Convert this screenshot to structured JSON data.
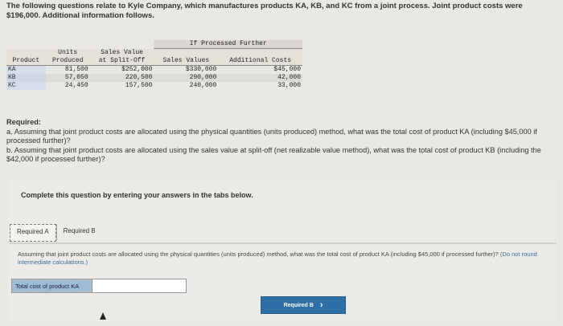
{
  "intro": "The following questions relate to Kyle Company, which manufactures products KA, KB, and KC from a joint process. Joint product costs were $196,000. Additional information follows.",
  "table": {
    "group_header": "If Processed Further",
    "col1a": "",
    "col1b": "Product",
    "col2a": "Units",
    "col2b": "Produced",
    "col3a": "Sales Value",
    "col3b": "at Split-Off",
    "col4a": "",
    "col4b": "Sales Values",
    "col5a": "",
    "col5b": "Additional Costs",
    "rows": [
      {
        "product": "KA",
        "units": "81,500",
        "split_off": "$252,000",
        "sales_values": "$330,000",
        "additional": "$45,000"
      },
      {
        "product": "KB",
        "units": "57,050",
        "split_off": "220,500",
        "sales_values": "290,000",
        "additional": "42,000"
      },
      {
        "product": "KC",
        "units": "24,450",
        "split_off": "157,500",
        "sales_values": "240,000",
        "additional": "33,000"
      }
    ]
  },
  "required": {
    "title": "Required:",
    "a": "a. Assuming that joint product costs are allocated using the physical quantities (units produced) method, what was the total cost of product KA (including $45,000 if processed further)?",
    "b": "b. Assuming that joint product costs are allocated using the sales value at split-off (net realizable value method), what was the total cost of product KB (including the $42,000 if processed further)?"
  },
  "complete_text": "Complete this question by entering your answers in the tabs below.",
  "tabs": [
    {
      "label": "Required A"
    },
    {
      "label": "Required B"
    }
  ],
  "question": {
    "text": "Assuming that joint product costs are allocated using the physical quantities (units produced) method, what was the total cost of product KA (including $45,000 if processed further)? ",
    "note": "(Do not round intermediate calculations.)"
  },
  "answer": {
    "label": "Total cost of product KA",
    "value": ""
  },
  "next_button": {
    "label": "Required B",
    "icon": "chevron-right-icon"
  },
  "colors": {
    "accent": "#2f6fa8",
    "answer_label_bg": "#9ebbd8"
  }
}
